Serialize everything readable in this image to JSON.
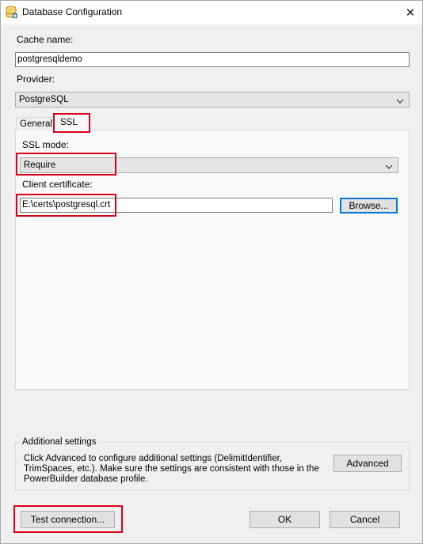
{
  "window": {
    "title": "Database Configuration",
    "app_icon": "database-icon",
    "close_glyph": "✕"
  },
  "form": {
    "cache_name_label": "Cache name:",
    "cache_name_value": "postgresqldemo",
    "provider_label": "Provider:",
    "provider_value": "PostgreSQL"
  },
  "tabs": [
    {
      "label": "General",
      "selected": false
    },
    {
      "label": "SSL",
      "selected": true
    }
  ],
  "ssl": {
    "mode_label": "SSL mode:",
    "mode_value": "Require",
    "cert_label": "Client certificate:",
    "cert_value": "E:\\certs\\postgresql.crt",
    "browse_label": "Browse..."
  },
  "additional": {
    "group_title": "Additional settings",
    "description": "Click Advanced to configure additional settings (DelimitIdentifier, TrimSpaces, etc.). Make sure the settings are consistent with those in the PowerBuilder database profile.",
    "advanced_label": "Advanced"
  },
  "footer": {
    "test_label": "Test connection...",
    "ok_label": "OK",
    "cancel_label": "Cancel"
  },
  "colors": {
    "highlight": "#d9001b",
    "focus": "#0078d7"
  }
}
